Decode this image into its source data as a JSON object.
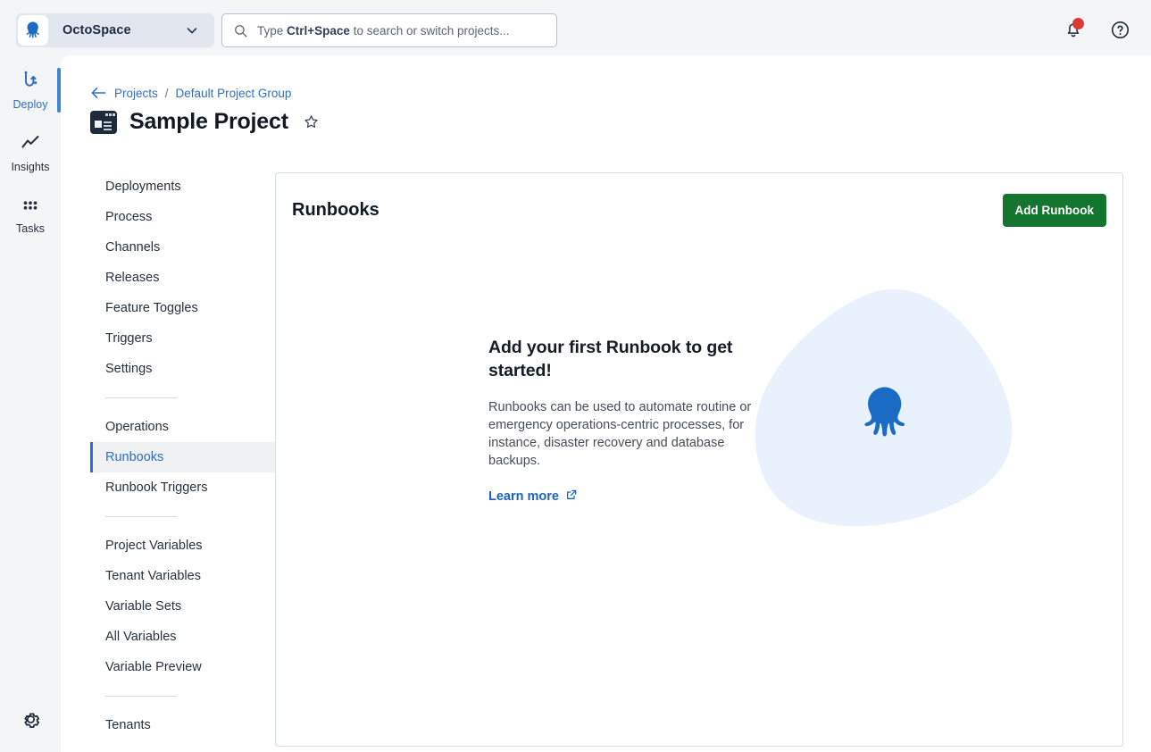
{
  "topbar": {
    "project_switcher": {
      "label": "OctoSpace",
      "logo_icon": "octopus-logo-icon",
      "caret_icon": "chevron-down-icon"
    },
    "search": {
      "icon": "search-icon",
      "placeholder_prefix": "Type ",
      "placeholder_keys": "Ctrl+Space",
      "placeholder_suffix": " to search or switch projects..."
    },
    "actions": [
      {
        "name": "notifications-button",
        "icon": "bell-icon",
        "has_badge": true
      },
      {
        "name": "help-button",
        "icon": "question-circle-icon",
        "has_badge": false
      }
    ]
  },
  "rail": {
    "items": [
      {
        "label": "Deploy",
        "icon": "deploy-icon",
        "active": true
      },
      {
        "label": "Insights",
        "icon": "insights-chart-icon",
        "active": false
      },
      {
        "label": "Tasks",
        "icon": "tasks-grid-icon",
        "active": false
      }
    ],
    "settings": {
      "label": "Settings",
      "icon": "gear-icon"
    }
  },
  "breadcrumb": {
    "back_icon": "arrow-left-icon",
    "items": [
      "Projects",
      "Default Project Group"
    ],
    "separator": "/"
  },
  "page": {
    "title": "Sample Project",
    "project_icon": "project-window-icon",
    "favorite_icon": "star-outline-icon"
  },
  "project_nav": {
    "groups": [
      {
        "items": [
          {
            "label": "Deployments",
            "active": false
          },
          {
            "label": "Process",
            "active": false
          },
          {
            "label": "Channels",
            "active": false
          },
          {
            "label": "Releases",
            "active": false
          },
          {
            "label": "Feature Toggles",
            "active": false
          },
          {
            "label": "Triggers",
            "active": false
          },
          {
            "label": "Settings",
            "active": false
          }
        ]
      },
      {
        "items": [
          {
            "label": "Operations",
            "active": false
          },
          {
            "label": "Runbooks",
            "active": true
          },
          {
            "label": "Runbook Triggers",
            "active": false
          }
        ]
      },
      {
        "items": [
          {
            "label": "Project Variables",
            "active": false
          },
          {
            "label": "Tenant Variables",
            "active": false
          },
          {
            "label": "Variable Sets",
            "active": false
          },
          {
            "label": "All Variables",
            "active": false
          },
          {
            "label": "Variable Preview",
            "active": false
          }
        ]
      },
      {
        "items": [
          {
            "label": "Tenants",
            "active": false
          }
        ]
      }
    ]
  },
  "card": {
    "title": "Runbooks",
    "add_button_label": "Add Runbook"
  },
  "empty_state": {
    "heading": "Add your first Runbook to get started!",
    "body": "Runbooks can be used to automate routine or emergency operations-centric processes, for instance, disaster recovery and database backups.",
    "learn_more_label": "Learn more",
    "learn_more_icon": "external-link-icon",
    "illustration_icon": "octopus-illustration"
  },
  "colors": {
    "accent_blue": "#2f6fc4",
    "link_blue": "#1a62c4",
    "primary_green": "#14752f",
    "badge_red": "#db3b34",
    "rail_active": "#3d84d4",
    "blob_light_blue": "#e8f1fc",
    "octopus_blue": "#1a6bc4",
    "page_bg": "#f4f5f7"
  }
}
